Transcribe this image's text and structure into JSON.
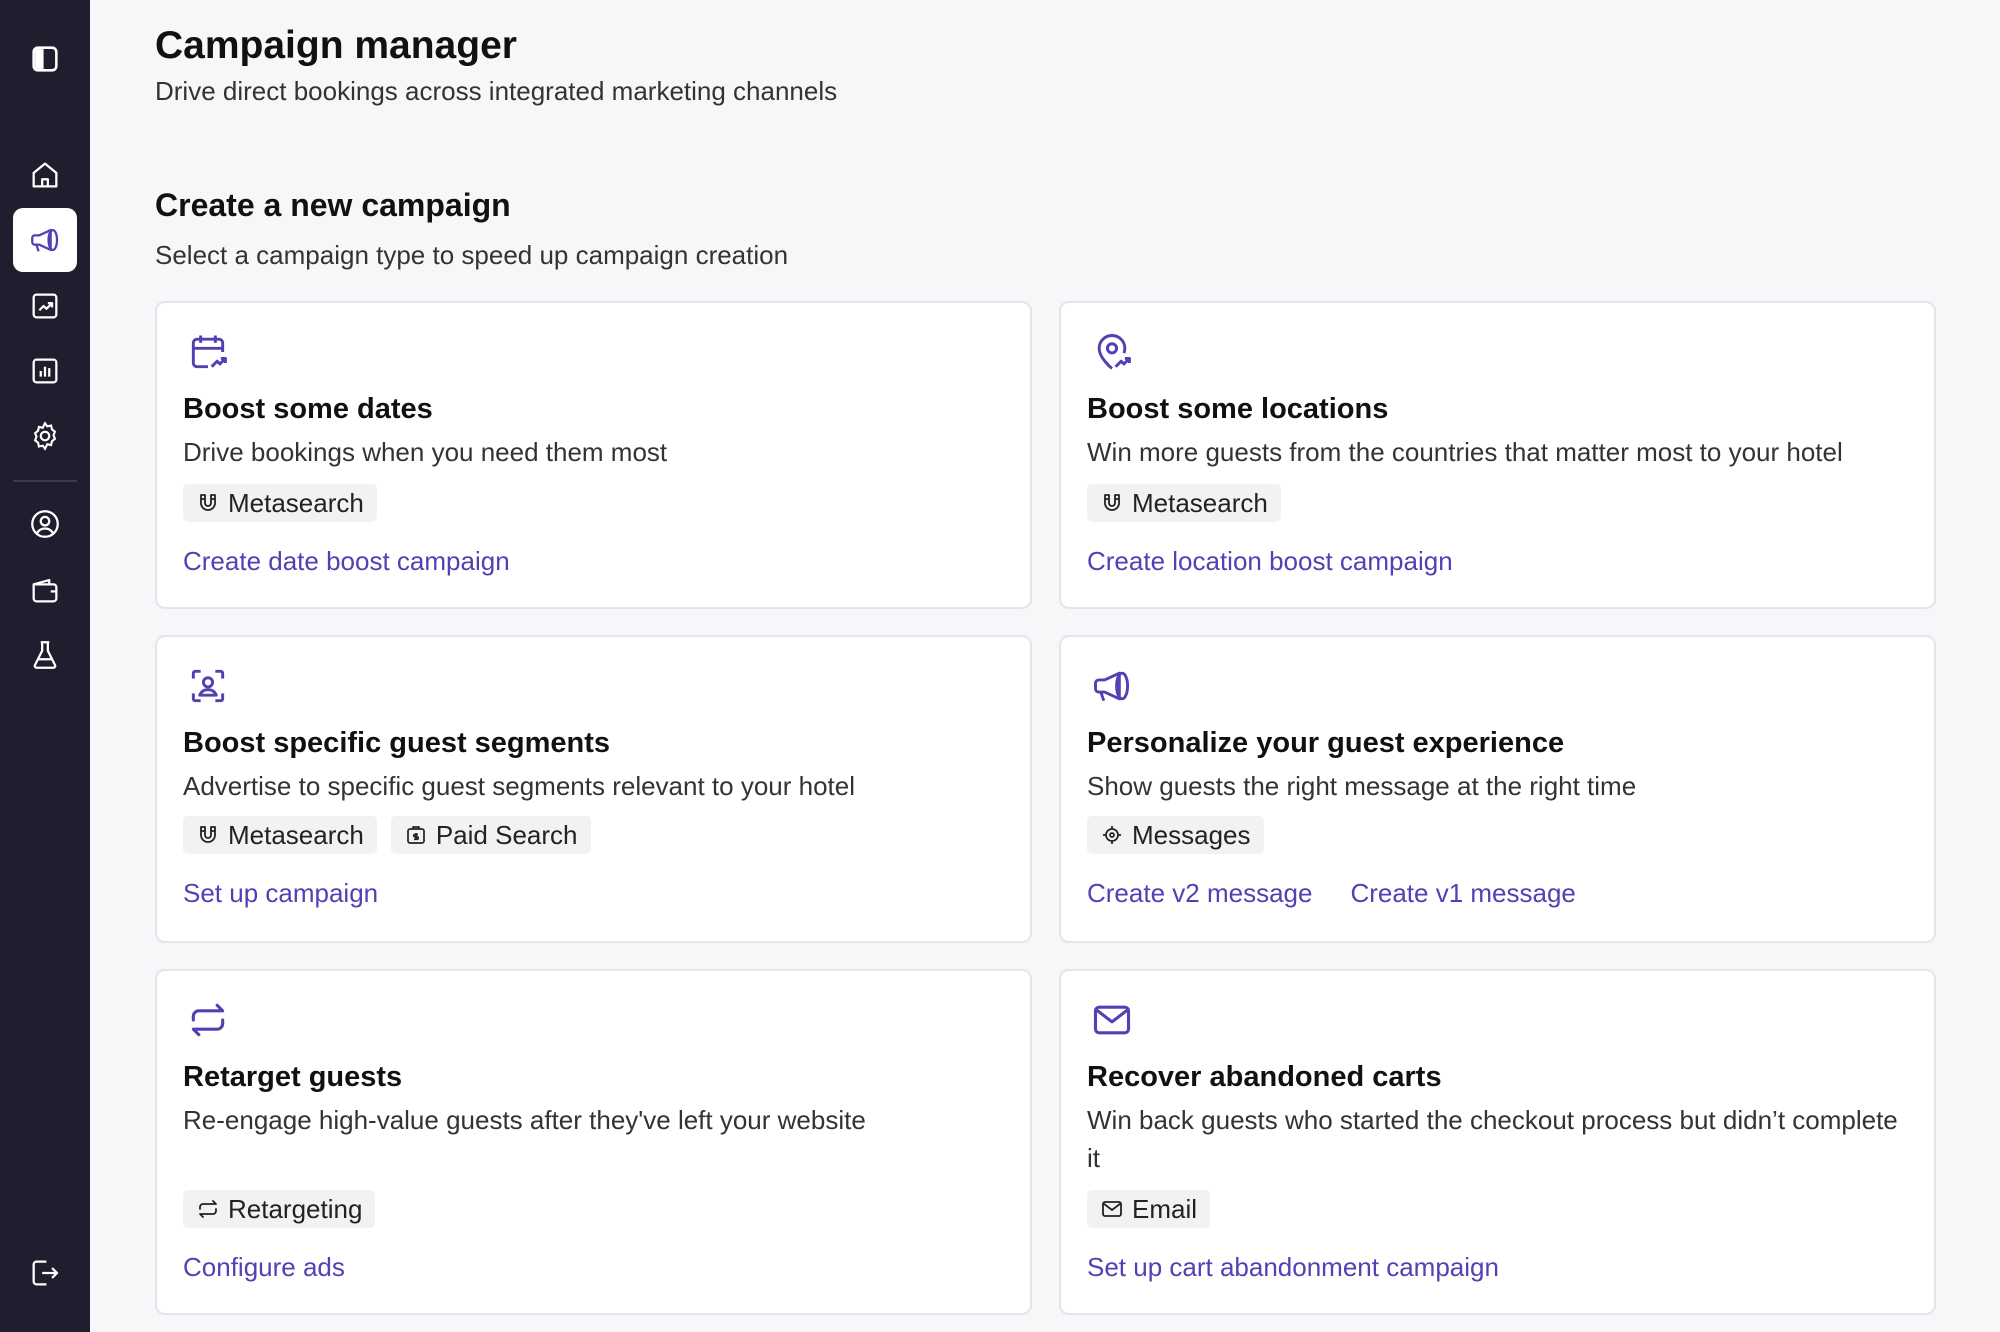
{
  "header": {
    "title": "Campaign manager",
    "subtitle": "Drive direct bookings across integrated marketing channels"
  },
  "section": {
    "title": "Create a new campaign",
    "subtitle": "Select a campaign type to speed up campaign creation"
  },
  "sidebar": {
    "items": [
      {
        "icon": "sidebar-toggle-icon"
      },
      {
        "icon": "home-icon"
      },
      {
        "icon": "megaphone-icon",
        "active": true
      },
      {
        "icon": "trending-chart-icon"
      },
      {
        "icon": "bar-chart-icon"
      },
      {
        "icon": "gear-icon"
      },
      {
        "icon": "user-circle-icon"
      },
      {
        "icon": "wallet-icon"
      },
      {
        "icon": "flask-icon"
      },
      {
        "icon": "logout-icon"
      }
    ]
  },
  "cards": [
    {
      "icon": "calendar-trend-icon",
      "title": "Boost some dates",
      "desc": "Drive bookings when you need them most",
      "tags": [
        {
          "icon": "magnet-icon",
          "label": "Metasearch"
        }
      ],
      "links": [
        "Create date boost campaign"
      ]
    },
    {
      "icon": "location-trend-icon",
      "title": "Boost some locations",
      "desc": "Win more guests from the countries that matter most to your hotel",
      "tags": [
        {
          "icon": "magnet-icon",
          "label": "Metasearch"
        }
      ],
      "links": [
        "Create location boost campaign"
      ]
    },
    {
      "icon": "user-focus-icon",
      "title": "Boost specific guest segments",
      "desc": "Advertise to specific guest segments relevant to your hotel",
      "tags": [
        {
          "icon": "magnet-icon",
          "label": "Metasearch"
        },
        {
          "icon": "paid-search-icon",
          "label": "Paid Search"
        }
      ],
      "links": [
        "Set up campaign"
      ]
    },
    {
      "icon": "megaphone-icon",
      "title": "Personalize your guest experience",
      "desc": "Show guests the right message at the right time",
      "tags": [
        {
          "icon": "target-icon",
          "label": "Messages"
        }
      ],
      "links": [
        "Create v2 message",
        "Create v1 message"
      ]
    },
    {
      "icon": "retarget-icon",
      "title": "Retarget guests",
      "desc": "Re-engage high-value guests after they've left your website",
      "tags": [
        {
          "icon": "retarget-icon",
          "label": "Retargeting"
        }
      ],
      "links": [
        "Configure ads"
      ]
    },
    {
      "icon": "mail-icon",
      "title": "Recover abandoned carts",
      "desc": "Win back guests who started the checkout process but didn’t complete it",
      "tags": [
        {
          "icon": "mail-icon",
          "label": "Email"
        }
      ],
      "links": [
        "Set up cart abandonment campaign"
      ]
    }
  ],
  "colors": {
    "sidebar_bg": "#1e1e2e",
    "accent": "#5340b4",
    "page_bg": "#f7f7f9"
  }
}
